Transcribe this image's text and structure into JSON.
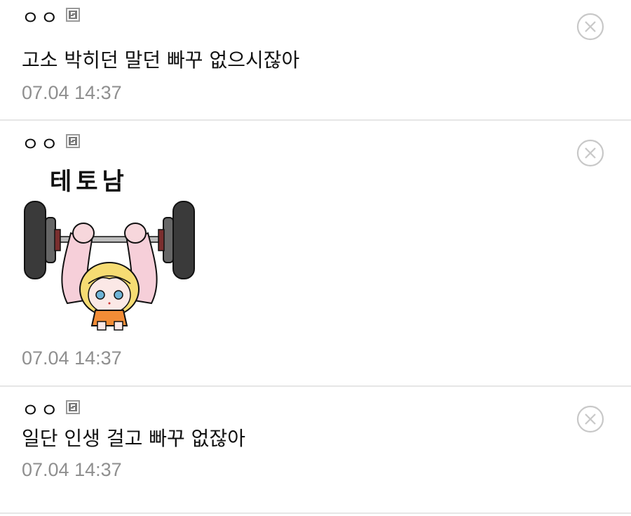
{
  "comments": [
    {
      "nickname": "ㅇㅇ",
      "text": "고소 박히던 말던 빠꾸 없으시잖아",
      "date": "07.04 14:37",
      "delete_icon": "circle-x-icon",
      "member_icon": "gallog-icon"
    },
    {
      "nickname": "ㅇㅇ",
      "dccon_caption": "테토남",
      "date": "07.04 14:37",
      "delete_icon": "circle-x-icon",
      "member_icon": "gallog-icon"
    },
    {
      "nickname": "ㅇㅇ",
      "text": "일단 인생 걸고 빠꾸 없잖아",
      "date": "07.04 14:37",
      "delete_icon": "circle-x-icon",
      "member_icon": "gallog-icon"
    }
  ],
  "colors": {
    "text": "#111111",
    "date": "#8f8f8f",
    "divider": "#e6e6e6",
    "delete_icon": "#c8c8c8"
  }
}
